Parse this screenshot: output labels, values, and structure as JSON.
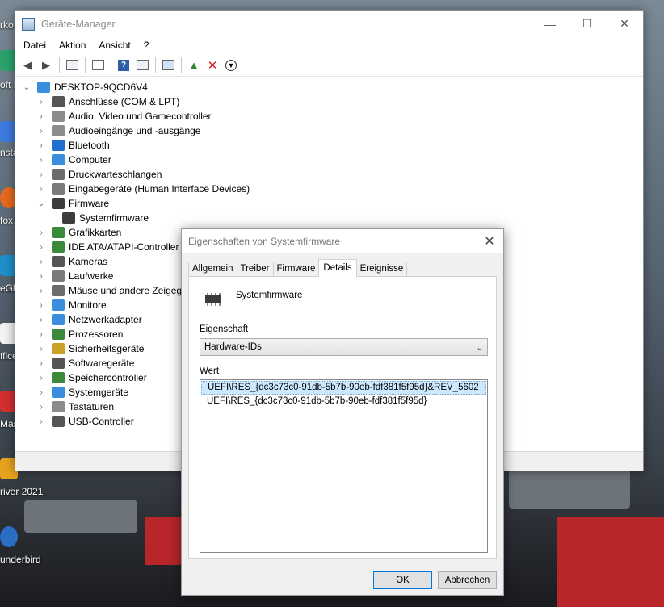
{
  "window": {
    "title": "Geräte-Manager",
    "minimize": "—",
    "maximize": "☐",
    "close": "✕"
  },
  "menubar": [
    "Datei",
    "Aktion",
    "Ansicht",
    "?"
  ],
  "tree": {
    "root": "DESKTOP-9QCD6V4",
    "items": [
      {
        "label": "Anschlüsse (COM & LPT)",
        "icon": "port-icon",
        "color": "#555555",
        "expanded": false
      },
      {
        "label": "Audio, Video und Gamecontroller",
        "icon": "speaker-icon",
        "color": "#8c8c8c",
        "expanded": false
      },
      {
        "label": "Audioeingänge und -ausgänge",
        "icon": "speaker-icon",
        "color": "#8c8c8c",
        "expanded": false
      },
      {
        "label": "Bluetooth",
        "icon": "bluetooth-icon",
        "color": "#1f6fd1",
        "expanded": false
      },
      {
        "label": "Computer",
        "icon": "monitor-icon",
        "color": "#3a8edb",
        "expanded": false
      },
      {
        "label": "Druckwarteschlangen",
        "icon": "printer-icon",
        "color": "#6b6b6b",
        "expanded": false
      },
      {
        "label": "Eingabegeräte (Human Interface Devices)",
        "icon": "hid-icon",
        "color": "#7a7a7a",
        "expanded": false
      },
      {
        "label": "Firmware",
        "icon": "chip-icon",
        "color": "#3d3d3d",
        "expanded": true
      },
      {
        "label": "Systemfirmware",
        "icon": "chip-icon",
        "color": "#3d3d3d",
        "child": true
      },
      {
        "label": "Grafikkarten",
        "icon": "display-adapter-icon",
        "color": "#3b8a3b",
        "expanded": false
      },
      {
        "label": "IDE ATA/ATAPI-Controller",
        "icon": "ide-icon",
        "color": "#3b8a3b",
        "expanded": false
      },
      {
        "label": "Kameras",
        "icon": "camera-icon",
        "color": "#555555",
        "expanded": false
      },
      {
        "label": "Laufwerke",
        "icon": "drive-icon",
        "color": "#7a7a7a",
        "expanded": false
      },
      {
        "label": "Mäuse und andere Zeigegeräte",
        "icon": "mouse-icon",
        "color": "#6b6b6b",
        "expanded": false
      },
      {
        "label": "Monitore",
        "icon": "monitor-icon",
        "color": "#3a8edb",
        "expanded": false
      },
      {
        "label": "Netzwerkadapter",
        "icon": "network-icon",
        "color": "#3a8edb",
        "expanded": false
      },
      {
        "label": "Prozessoren",
        "icon": "cpu-icon",
        "color": "#3b8a3b",
        "expanded": false
      },
      {
        "label": "Sicherheitsgeräte",
        "icon": "security-icon",
        "color": "#c9a227",
        "expanded": false
      },
      {
        "label": "Softwaregeräte",
        "icon": "software-device-icon",
        "color": "#555555",
        "expanded": false
      },
      {
        "label": "Speichercontroller",
        "icon": "storage-icon",
        "color": "#3b8a3b",
        "expanded": false
      },
      {
        "label": "Systemgeräte",
        "icon": "system-icon",
        "color": "#3a8edb",
        "expanded": false
      },
      {
        "label": "Tastaturen",
        "icon": "keyboard-icon",
        "color": "#8c8c8c",
        "expanded": false
      },
      {
        "label": "USB-Controller",
        "icon": "usb-icon",
        "color": "#555555",
        "expanded": false
      }
    ]
  },
  "dialog": {
    "title": "Eigenschaften von Systemfirmware",
    "close": "✕",
    "tabs": [
      "Allgemein",
      "Treiber",
      "Firmware",
      "Details",
      "Ereignisse"
    ],
    "active_tab": "Details",
    "device_name": "Systemfirmware",
    "property_label": "Eigenschaft",
    "property_value": "Hardware-IDs",
    "value_label": "Wert",
    "values": [
      "UEFI\\RES_{dc3c73c0-91db-5b7b-90eb-fdf381f5f95d}&REV_5602",
      "UEFI\\RES_{dc3c73c0-91db-5b7b-90eb-fdf381f5f95d}"
    ],
    "ok": "OK",
    "cancel": "Abbrechen"
  },
  "desktop_labels": [
    "rko",
    "oft E",
    "nsta",
    "fox",
    "eGla",
    "ffice",
    "Mas",
    "river 2021",
    "underbird"
  ]
}
